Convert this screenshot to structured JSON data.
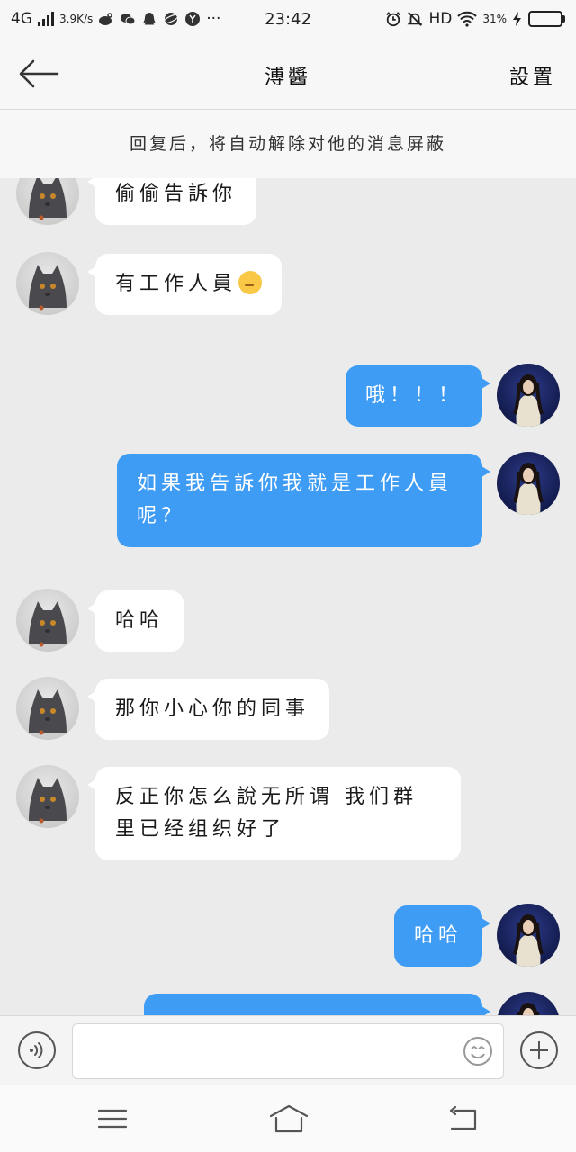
{
  "status_bar": {
    "network": "4G",
    "speed": "3.9K/s",
    "time": "23:42",
    "hd": "HD",
    "battery_text": "31%",
    "battery_level": 0.31
  },
  "header": {
    "title": "溥醬",
    "settings_label": "設置"
  },
  "notice": "回复后，将自动解除对他的消息屏蔽",
  "messages": [
    {
      "side": "left",
      "text": "偷偷告訴你"
    },
    {
      "side": "left",
      "text": "有工作人員"
    },
    {
      "side": "right",
      "text": "哦！！！"
    },
    {
      "side": "right",
      "text": "如果我告訴你我就是工作人員呢？"
    },
    {
      "side": "left",
      "text": "哈哈"
    },
    {
      "side": "left",
      "text": "那你小心你的同事"
    },
    {
      "side": "left",
      "text": "反正你怎么說无所谓 我们群里已经组织好了"
    },
    {
      "side": "right",
      "text": "哈哈"
    }
  ],
  "input": {
    "placeholder": ""
  },
  "icons": {
    "back": "arrow-left-icon",
    "voice": "voice-icon",
    "emoji": "smiley-icon",
    "plus": "plus-icon",
    "menu": "menu-icon",
    "home": "home-icon",
    "return": "return-icon"
  }
}
